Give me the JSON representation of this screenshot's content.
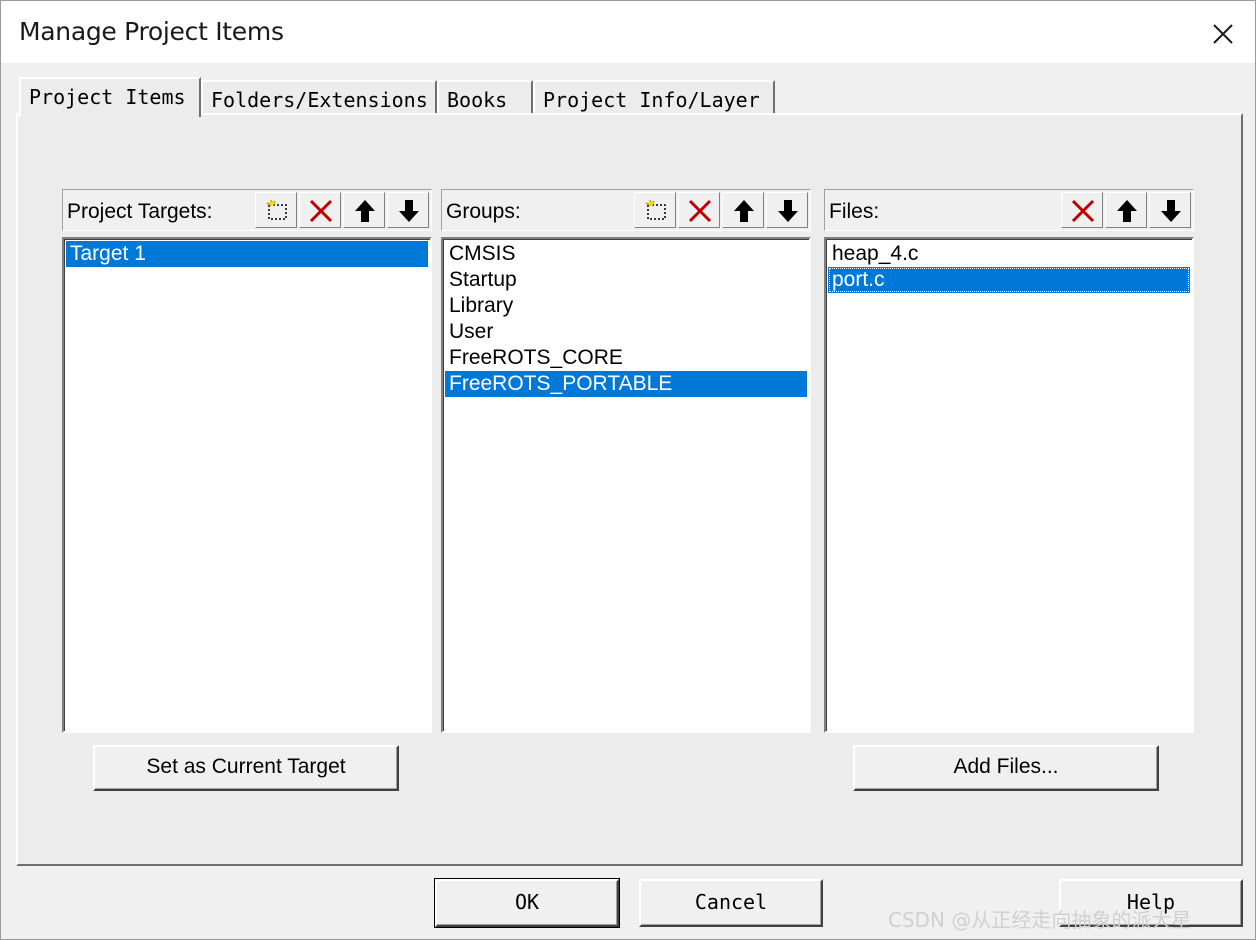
{
  "window": {
    "title": "Manage Project Items"
  },
  "tabs": [
    {
      "label": "Project Items",
      "active": true
    },
    {
      "label": "Folders/Extensions"
    },
    {
      "label": "Books"
    },
    {
      "label": "Project Info/Layer"
    }
  ],
  "targets": {
    "header": "Project Targets:",
    "items": [
      "Target 1"
    ],
    "selected": "Target 1"
  },
  "groups": {
    "header": "Groups:",
    "items": [
      "CMSIS",
      "Startup",
      "Library",
      "User",
      "FreeROTS_CORE",
      "FreeROTS_PORTABLE"
    ],
    "selected": "FreeROTS_PORTABLE"
  },
  "files": {
    "header": "Files:",
    "items": [
      "heap_4.c",
      "port.c"
    ],
    "selected": "port.c"
  },
  "buttons": {
    "set_current": "Set as Current Target",
    "add_files": "Add Files...",
    "ok": "OK",
    "cancel": "Cancel",
    "help": "Help"
  },
  "icons": {
    "new": "new-item-icon",
    "delete": "delete-x-icon",
    "up": "move-up-arrow-icon",
    "down": "move-down-arrow-icon",
    "close": "close-icon"
  },
  "colors": {
    "selection": "#0078d7",
    "delete_red": "#c00000",
    "face": "#f0f0f0"
  },
  "watermark": "CSDN @从正经走向抽象的派大星"
}
